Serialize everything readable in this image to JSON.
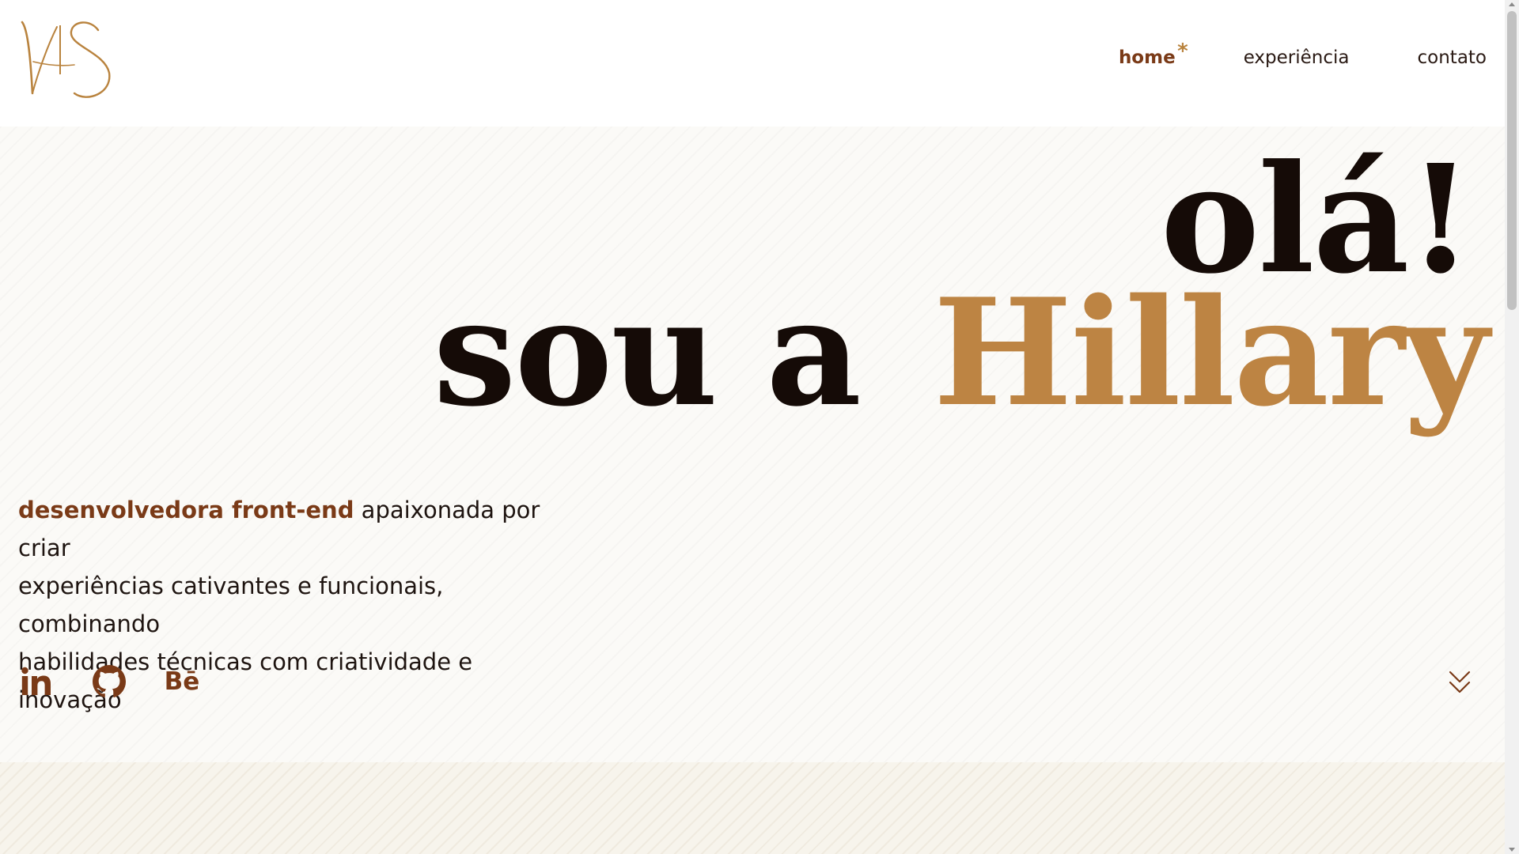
{
  "header": {
    "logo_icon": "vs-monogram-logo",
    "nav": [
      {
        "label": "home",
        "active": true,
        "marker": "*"
      },
      {
        "label": "experiência",
        "active": false
      },
      {
        "label": "contato",
        "active": false
      }
    ]
  },
  "hero": {
    "greeting": "olá!",
    "intro_prefix": "sou a",
    "name": "Hillary",
    "description_highlight": "desenvolvedora front-end",
    "description_line1_rest": " apaixonada por criar",
    "description_line2": "experiências cativantes e funcionais, combinando",
    "description_line3": "habilidades técnicas com criatividade e inovação"
  },
  "socials": [
    {
      "icon": "linkedin-icon",
      "label": "in"
    },
    {
      "icon": "github-icon"
    },
    {
      "icon": "behance-icon",
      "label": "Bē"
    }
  ],
  "scroll_icon": "double-chevron-down-icon",
  "colors": {
    "accent_dark": "#7a3a17",
    "accent_gold": "#bd8443",
    "text_dark": "#150b07",
    "background": "#fbfaf7"
  }
}
